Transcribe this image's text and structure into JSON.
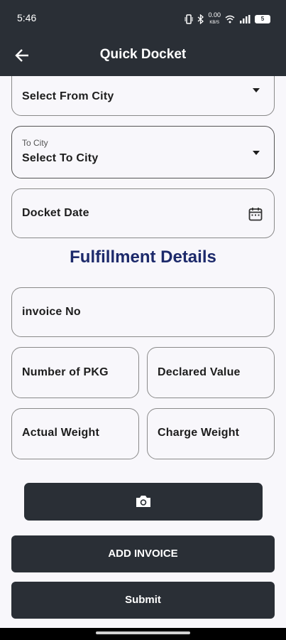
{
  "status": {
    "time": "5:46",
    "network_speed_top": "0.00",
    "network_speed_bottom": "KB/S",
    "battery": "5"
  },
  "appbar": {
    "back_icon": "arrow-left-icon",
    "title": "Quick Docket"
  },
  "form": {
    "from_city": {
      "value": "Select From City"
    },
    "to_city": {
      "label": "To City",
      "value": "Select To City"
    },
    "docket_date": {
      "placeholder": "Docket Date",
      "icon": "calendar-icon"
    },
    "section_title": "Fulfillment Details",
    "invoice_no": {
      "placeholder": "invoice No"
    },
    "number_of_pkg": {
      "placeholder": "Number of PKG"
    },
    "declared_value": {
      "placeholder": "Declared Value"
    },
    "actual_weight": {
      "placeholder": "Actual Weight"
    },
    "charge_weight": {
      "placeholder": "Charge Weight"
    }
  },
  "actions": {
    "camera_icon": "camera-icon",
    "add_invoice": "ADD INVOICE",
    "submit": "Submit"
  },
  "colors": {
    "primary_dark": "#2a2f36",
    "section_title": "#1d2a6b",
    "background": "#f8f7fb"
  }
}
